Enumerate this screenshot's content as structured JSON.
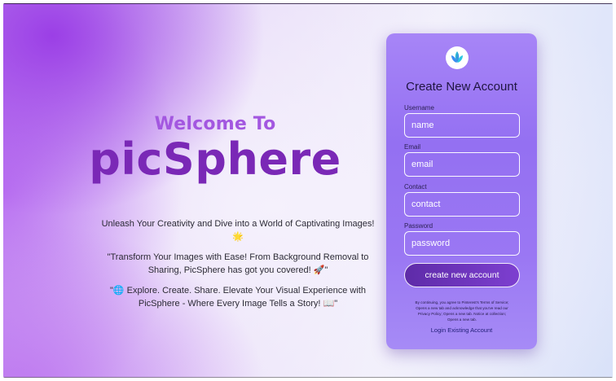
{
  "hero": {
    "welcome": "Welcome To",
    "brand": "picSphere",
    "taglines": [
      "Unleash Your Creativity and Dive into a World of Captivating Images! 🌟",
      "\"Transform Your Images with Ease! From Background Removal to Sharing, PicSphere has got you covered! 🚀\"",
      "\"🌐 Explore. Create. Share. Elevate Your Visual Experience with PicSphere - Where Every Image Tells a Story! 📖\""
    ]
  },
  "form": {
    "logo_icon": "leaf-logo-icon",
    "title": "Create New Account",
    "fields": [
      {
        "label": "Username",
        "placeholder": "name"
      },
      {
        "label": "Email",
        "placeholder": "email"
      },
      {
        "label": "Contact",
        "placeholder": "contact"
      },
      {
        "label": "Password",
        "placeholder": "password"
      }
    ],
    "submit_label": "create new account",
    "terms": "By continuing, you agree to Pinterest's Terms of Service; Opens a new tab and acknowledge that you've read our Privacy Policy; Opens a new tab. Notice at collection; Opens a new tab.",
    "login_link": "Login Existing Account"
  },
  "colors": {
    "accent": "#7a28b6",
    "button": "#6a32b8",
    "card": "#9a77f3"
  }
}
